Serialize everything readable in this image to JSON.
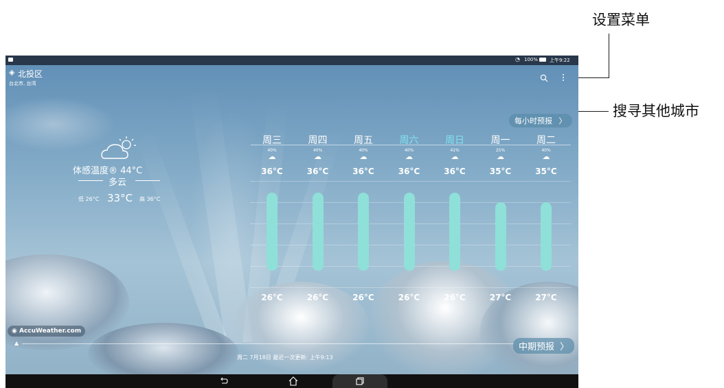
{
  "callouts": {
    "settings_menu": "设置菜单",
    "search_other_cities": "搜寻其他城市"
  },
  "status_bar": {
    "battery": "100%",
    "time": "上午9:22"
  },
  "location": {
    "district": "北投区",
    "city": "台北市, 台湾"
  },
  "current": {
    "feels_like": "体感温度® 44°C",
    "condition": "多云",
    "low_label": "低 26°C",
    "temp": "33°C",
    "high_label": "高 36°C"
  },
  "buttons": {
    "hourly": "每小时预报",
    "extended": "中期预报"
  },
  "forecast": [
    {
      "day": "周三",
      "precip": "40%",
      "high": "36°C",
      "low": "26°C",
      "weekend": false
    },
    {
      "day": "周四",
      "precip": "40%",
      "high": "36°C",
      "low": "26°C",
      "weekend": false
    },
    {
      "day": "周五",
      "precip": "40%",
      "high": "36°C",
      "low": "26°C",
      "weekend": false
    },
    {
      "day": "周六",
      "precip": "40%",
      "high": "36°C",
      "low": "26°C",
      "weekend": true
    },
    {
      "day": "周日",
      "precip": "41%",
      "high": "36°C",
      "low": "26°C",
      "weekend": true
    },
    {
      "day": "周一",
      "precip": "25%",
      "high": "35°C",
      "low": "27°C",
      "weekend": false
    },
    {
      "day": "周二",
      "precip": "40%",
      "high": "35°C",
      "low": "27°C",
      "weekend": false
    }
  ],
  "provider": "AccuWeather.com",
  "update_text": "周二 7月18日 最近一次更新: 上午9:13",
  "colors": {
    "bar": "#8fe0d8",
    "weekend_day": "#7fe3f0",
    "button_accent": "#7fe3f0"
  },
  "icons": {
    "location": "location-diamond-icon",
    "search": "search-icon",
    "menu": "overflow-menu-icon",
    "weather": "partly-cloudy-icon",
    "back": "back-icon",
    "home": "home-icon",
    "recents": "recents-icon"
  }
}
